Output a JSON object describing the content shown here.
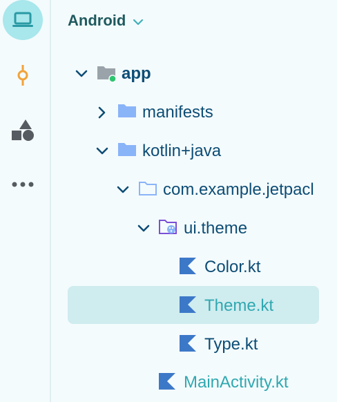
{
  "header": {
    "title": "Android"
  },
  "rail": {
    "items": [
      {
        "icon": "laptop-icon",
        "active": true
      },
      {
        "icon": "commit-icon",
        "active": false
      },
      {
        "icon": "shapes-icon",
        "active": false
      },
      {
        "icon": "more-horizontal-icon",
        "active": false
      }
    ]
  },
  "tree": {
    "items": [
      {
        "label": "app",
        "icon": "module-folder-icon",
        "expanded": true,
        "level": 0
      },
      {
        "label": "manifests",
        "icon": "folder-icon",
        "expanded": false,
        "level": 1
      },
      {
        "label": "kotlin+java",
        "icon": "folder-icon",
        "expanded": true,
        "level": 1
      },
      {
        "label": "com.example.jetpacl",
        "icon": "package-folder-icon",
        "expanded": true,
        "level": 2
      },
      {
        "label": "ui.theme",
        "icon": "theme-package-icon",
        "expanded": true,
        "level": 3
      },
      {
        "label": "Color.kt",
        "icon": "kotlin-file-icon",
        "level": 4
      },
      {
        "label": "Theme.kt",
        "icon": "kotlin-file-icon",
        "level": 4,
        "selected": true
      },
      {
        "label": "Type.kt",
        "icon": "kotlin-file-icon",
        "level": 4
      },
      {
        "label": "MainActivity.kt",
        "icon": "kotlin-file-icon",
        "level": 3
      }
    ]
  },
  "colors": {
    "accent": "#30a8b0",
    "text": "#0d4d75",
    "selection": "#cfecef",
    "folder": "#8ab4f8"
  }
}
